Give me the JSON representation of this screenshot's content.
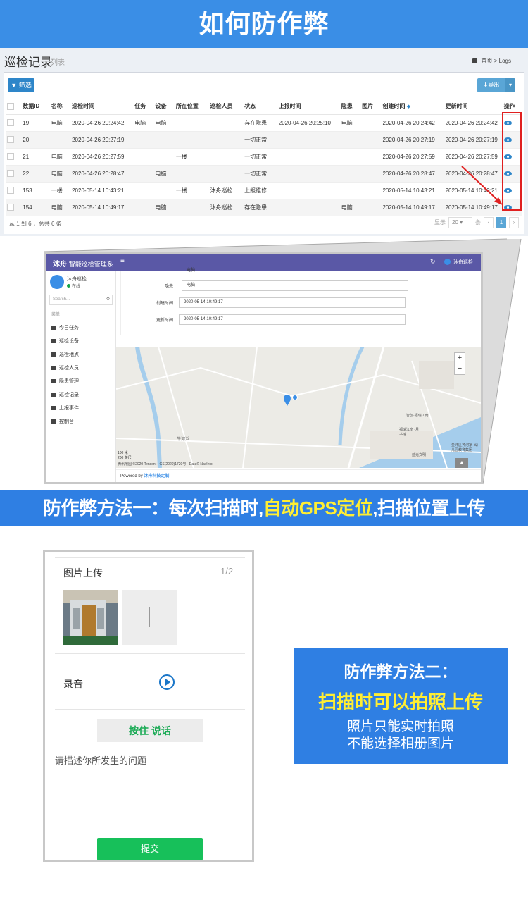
{
  "banner": {
    "title": "如何防作弊"
  },
  "admin": {
    "title": "巡检记录",
    "subtitle": "列表",
    "breadcrumb_home": "首页",
    "breadcrumb_sep": ">",
    "breadcrumb_current": "Logs",
    "filter_label": "筛选",
    "export_label": "导出",
    "columns": [
      "数据ID",
      "名称",
      "巡检时间",
      "任务",
      "设备",
      "所在位置",
      "巡检人员",
      "状态",
      "上报时间",
      "隐患",
      "图片",
      "创建时间",
      "更新时间",
      "操作"
    ],
    "rows": [
      [
        "19",
        "电脑",
        "2020-04-26 20:24:42",
        "电脑",
        "电脑",
        "",
        "",
        "存在隐患",
        "2020-04-26 20:25:10",
        "电脑",
        "",
        "2020-04-26 20:24:42",
        "2020-04-26 20:24:42"
      ],
      [
        "20",
        "",
        "2020-04-26 20:27:19",
        "",
        "",
        "",
        "",
        "一切正常",
        "",
        "",
        "",
        "2020-04-26 20:27:19",
        "2020-04-26 20:27:19"
      ],
      [
        "21",
        "电脑",
        "2020-04-26 20:27:59",
        "",
        "",
        "一楼",
        "",
        "一切正常",
        "",
        "",
        "",
        "2020-04-26 20:27:59",
        "2020-04-26 20:27:59"
      ],
      [
        "22",
        "电脑",
        "2020-04-26 20:28:47",
        "",
        "电脑",
        "",
        "",
        "一切正常",
        "",
        "",
        "",
        "2020-04-26 20:28:47",
        "2020-04-26 20:28:47"
      ],
      [
        "153",
        "一楼",
        "2020-05-14 10:43:21",
        "",
        "",
        "一楼",
        "沐舟巡检",
        "上报维修",
        "",
        "",
        "",
        "2020-05-14 10:43:21",
        "2020-05-14 10:43:21"
      ],
      [
        "154",
        "电脑",
        "2020-05-14 10:49:17",
        "",
        "电脑",
        "",
        "沐舟巡检",
        "存在隐患",
        "",
        "电脑",
        "",
        "2020-05-14 10:49:17",
        "2020-05-14 10:49:17"
      ]
    ],
    "pager_info": "从 1 到 6 ，总共 6 条",
    "pager_show": "显示",
    "pager_size": "20",
    "pager_unit": "条",
    "pager_prev": "‹",
    "pager_page": "1",
    "pager_next": "›"
  },
  "detail": {
    "brand": "沐舟",
    "brand_sub": "智能巡检管理系",
    "menu_glyph": "≡",
    "refresh_glyph": "↻",
    "user": "沐舟巡检",
    "side_name": "沐舟巡检",
    "side_status": "在线",
    "search_placeholder": "Search...",
    "side_section": "菜单",
    "side_items": [
      "今日任务",
      "巡检设备",
      "巡检地点",
      "巡检人员",
      "隐患管理",
      "巡检记录",
      "上报事件",
      "控制台"
    ],
    "fields": [
      {
        "label": "隐患",
        "value": "电脑"
      },
      {
        "label": "创建时间",
        "value": "2020-05-14 10:49:17"
      },
      {
        "label": "更新时间",
        "value": "2020-05-14 10:49:17"
      }
    ],
    "top_field_value": "电脑",
    "zoom_in": "+",
    "zoom_out": "−",
    "map_scale_m": "100 米",
    "map_scale_ft": "200 英尺",
    "map_copyright": "腾讯地图 ©2020 Tencent - GS(2020)1720号 - Data© NavInfo",
    "map_label_1": "牛河浜",
    "map_label_2": "智创·福瑞江南",
    "map_label_3": "福瑞江南 -月书馆",
    "map_label_4": "金纬区齐河家 -幼儿园教育集团",
    "map_label_5": "蓝光文明",
    "footer_prefix": "Powered by ",
    "footer_link": "沐舟科技定制",
    "back_top": "▲"
  },
  "method1": {
    "prefix": "防作弊方法一：每次扫描时,",
    "highlight": "自动GPS定位",
    "suffix": ",扫描位置上传"
  },
  "phone": {
    "photo_label": "图片上传",
    "photo_count": "1/2",
    "record_label": "录音",
    "hold_label": "按住 说话",
    "desc_placeholder": "请描述你所发生的问题",
    "submit_label": "提交"
  },
  "method2": {
    "title": "防作弊方法二：",
    "highlight": "扫描时可以拍照上传",
    "line1": "照片只能实时拍照",
    "line2": "不能选择相册图片"
  },
  "colors": {
    "primary": "#3a8ee6",
    "banner_blue": "#2f7fe3",
    "highlight": "#ffee33",
    "nav_purple": "#5a58a6",
    "submit_green": "#17c05a",
    "callout_red": "#e02020"
  }
}
